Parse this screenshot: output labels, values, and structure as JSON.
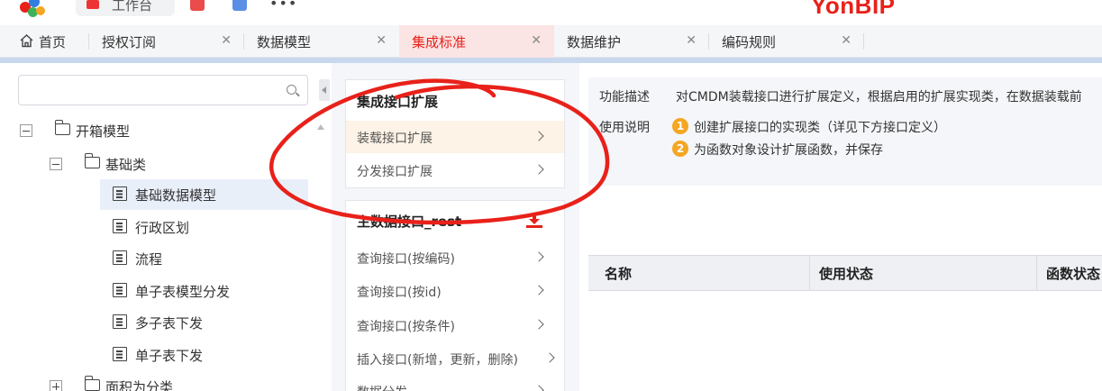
{
  "topbar": {
    "workbench_label": "工作台",
    "brand_text": "YonBIP"
  },
  "tabs": [
    {
      "label": "首页",
      "icon": "home-icon"
    },
    {
      "label": "授权订阅"
    },
    {
      "label": "数据模型"
    },
    {
      "label": "集成标准",
      "active": true
    },
    {
      "label": "数据维护"
    },
    {
      "label": "编码规则"
    }
  ],
  "tree": {
    "search_value": "",
    "nodes": [
      {
        "label": "开箱模型",
        "type": "folder",
        "expanded": true
      },
      {
        "label": "基础类",
        "type": "folder",
        "expanded": true
      },
      {
        "label": "基础数据模型",
        "type": "doc",
        "selected": true
      },
      {
        "label": "行政区划",
        "type": "doc"
      },
      {
        "label": "流程",
        "type": "doc"
      },
      {
        "label": "单子表模型分发",
        "type": "doc"
      },
      {
        "label": "多子表下发",
        "type": "doc"
      },
      {
        "label": "单子表下发",
        "type": "doc"
      },
      {
        "label": "面积为分类",
        "type": "folder",
        "expanded": false
      }
    ]
  },
  "middle": {
    "card1": {
      "title": "集成接口扩展",
      "items": [
        {
          "label": "装载接口扩展",
          "active": true
        },
        {
          "label": "分发接口扩展"
        }
      ]
    },
    "card2": {
      "title": "主数据接口_rest",
      "items": [
        {
          "label": "查询接口(按编码)"
        },
        {
          "label": "查询接口(按id)"
        },
        {
          "label": "查询接口(按条件)"
        },
        {
          "label": "插入接口(新增，更新，删除)"
        },
        {
          "label": "数据分发"
        }
      ]
    }
  },
  "right": {
    "desc_label": "功能描述",
    "desc_text": "对CMDM装载接口进行扩展定义，根据启用的扩展实现类，在数据装载前",
    "usage_label": "使用说明",
    "steps": [
      {
        "num": "1",
        "text": "创建扩展接口的实现类（详见下方接口定义）"
      },
      {
        "num": "2",
        "text": "为函数对象设计扩展函数，并保存"
      }
    ],
    "table_headers": [
      "名称",
      "使用状态",
      "函数状态"
    ]
  },
  "colors": {
    "brand_red": "#e8211a",
    "step_orange": "#f5a623",
    "active_item_bg": "#fdf3e6",
    "active_tab_bg": "#fbe4e4",
    "selected_node_bg": "#e9eff9"
  }
}
